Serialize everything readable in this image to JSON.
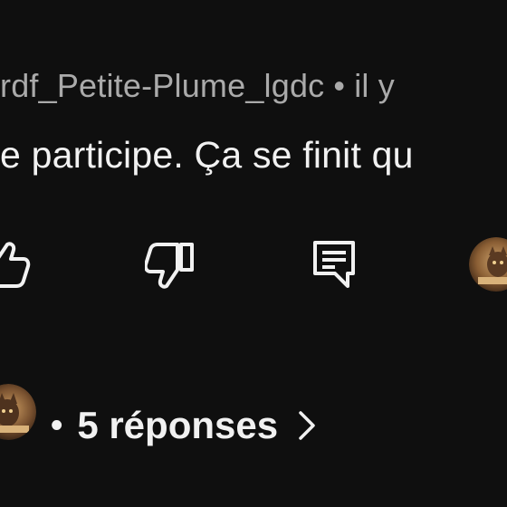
{
  "comment": {
    "username": "rdf_Petite-Plume_lgdc",
    "separator": "•",
    "time_text": "il y",
    "text": "e participe. Ça se finit qu"
  },
  "actions": {
    "like_icon": "thumbs-up-icon",
    "dislike_icon": "thumbs-down-icon",
    "reply_icon": "comment-reply-icon"
  },
  "replies": {
    "dot": "•",
    "label": "5 réponses",
    "chevron_icon": "chevron-right-icon"
  },
  "colors": {
    "background": "#0f0f0f",
    "primary_text": "#f1f1f1",
    "secondary_text": "#aaaaaa"
  }
}
